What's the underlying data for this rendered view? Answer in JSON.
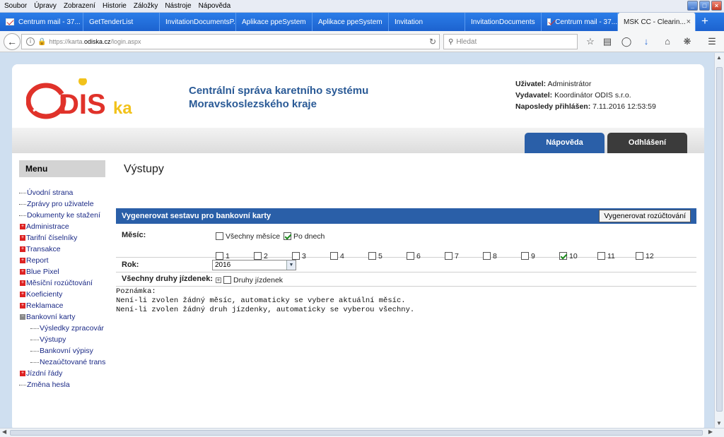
{
  "menubar": [
    "Soubor",
    "Úpravy",
    "Zobrazení",
    "Historie",
    "Záložky",
    "Nástroje",
    "Nápověda"
  ],
  "window_buttons": [
    "_",
    "□",
    "×"
  ],
  "tabs": [
    "Centrum mail - 37...",
    "GetTenderList",
    "InvitationDocumentsP...",
    "Aplikace ppeSystem",
    "Aplikace ppeSystem",
    "Invitation",
    "InvitationDocuments",
    "Centrum mail - 37...",
    "MSK CC - Clearin..."
  ],
  "tab_close": "×",
  "new_tab": "+",
  "url": {
    "prefix": "https://karta.",
    "domain": "odiska.cz",
    "suffix": "/login.aspx"
  },
  "search_placeholder": "Hledat",
  "header": {
    "logo_text": "ODISka",
    "title_line1": "Centrální správa karetního systému",
    "title_line2": "Moravskoslezského kraje",
    "user_label": "Uživatel:",
    "user_value": "Administrátor",
    "issuer_label": "Vydavatel:",
    "issuer_value": "Koordinátor ODIS s.r.o.",
    "lastlogin_label": "Naposledy přihlášen:",
    "lastlogin_value": "7.11.2016 12:53:59"
  },
  "buttons": {
    "help": "Nápověda",
    "logout": "Odhlášení",
    "generate": "Vygenerovat rozúčtování"
  },
  "menu": {
    "title": "Menu",
    "items": [
      {
        "label": "Úvodní strana",
        "type": "leaf"
      },
      {
        "label": "Zprávy pro uživatele",
        "type": "leaf"
      },
      {
        "label": "Dokumenty ke stažení",
        "type": "leaf"
      },
      {
        "label": "Administrace",
        "type": "plus"
      },
      {
        "label": "Tarifní číselníky",
        "type": "plus"
      },
      {
        "label": "Transakce",
        "type": "plus"
      },
      {
        "label": "Report",
        "type": "plus"
      },
      {
        "label": "Blue Pixel",
        "type": "plus"
      },
      {
        "label": "Měsíční rozúčtování",
        "type": "plus"
      },
      {
        "label": "Koeficienty",
        "type": "plus"
      },
      {
        "label": "Reklamace",
        "type": "plus"
      },
      {
        "label": "Bankovní karty",
        "type": "minus"
      },
      {
        "label": "Výsledky zpracovár",
        "type": "sub"
      },
      {
        "label": "Výstupy",
        "type": "sub"
      },
      {
        "label": "Bankovní výpisy",
        "type": "sub"
      },
      {
        "label": "Nezaúčtované trans",
        "type": "sub"
      },
      {
        "label": "Jízdní řády",
        "type": "plus"
      },
      {
        "label": "Změna hesla",
        "type": "leaf"
      }
    ]
  },
  "content": {
    "page_title": "Výstupy",
    "section_title": "Vygenerovat sestavu pro bankovní karty",
    "month_label": "Měsíc:",
    "all_months_label": "Všechny měsíce",
    "all_months_checked": false,
    "by_days_label": "Po dnech",
    "by_days_checked": true,
    "months": [
      {
        "label": "1",
        "checked": false
      },
      {
        "label": "2",
        "checked": false
      },
      {
        "label": "3",
        "checked": false
      },
      {
        "label": "4",
        "checked": false
      },
      {
        "label": "5",
        "checked": false
      },
      {
        "label": "6",
        "checked": false
      },
      {
        "label": "7",
        "checked": false
      },
      {
        "label": "8",
        "checked": false
      },
      {
        "label": "9",
        "checked": false
      },
      {
        "label": "10",
        "checked": true
      },
      {
        "label": "11",
        "checked": false
      },
      {
        "label": "12",
        "checked": false
      }
    ],
    "year_label": "Rok:",
    "year_value": "2016",
    "ticket_types_label": "Všechny druhy jízdenek:",
    "ticket_types_option": "Druhy jízdenek",
    "ticket_types_checked": false,
    "note_title": "Poznámka:",
    "note_line1": "Není-li zvolen žádný měsíc, automaticky se vybere aktuální měsíc.",
    "note_line2": "Není-li zvolen žádný druh jízdenky, automaticky se vyberou všechny."
  },
  "colors": {
    "accent_blue": "#2a5fa8",
    "tab_blue": "#1c62cf",
    "logo_red": "#e0322a",
    "logo_yellow": "#f2c21b"
  }
}
